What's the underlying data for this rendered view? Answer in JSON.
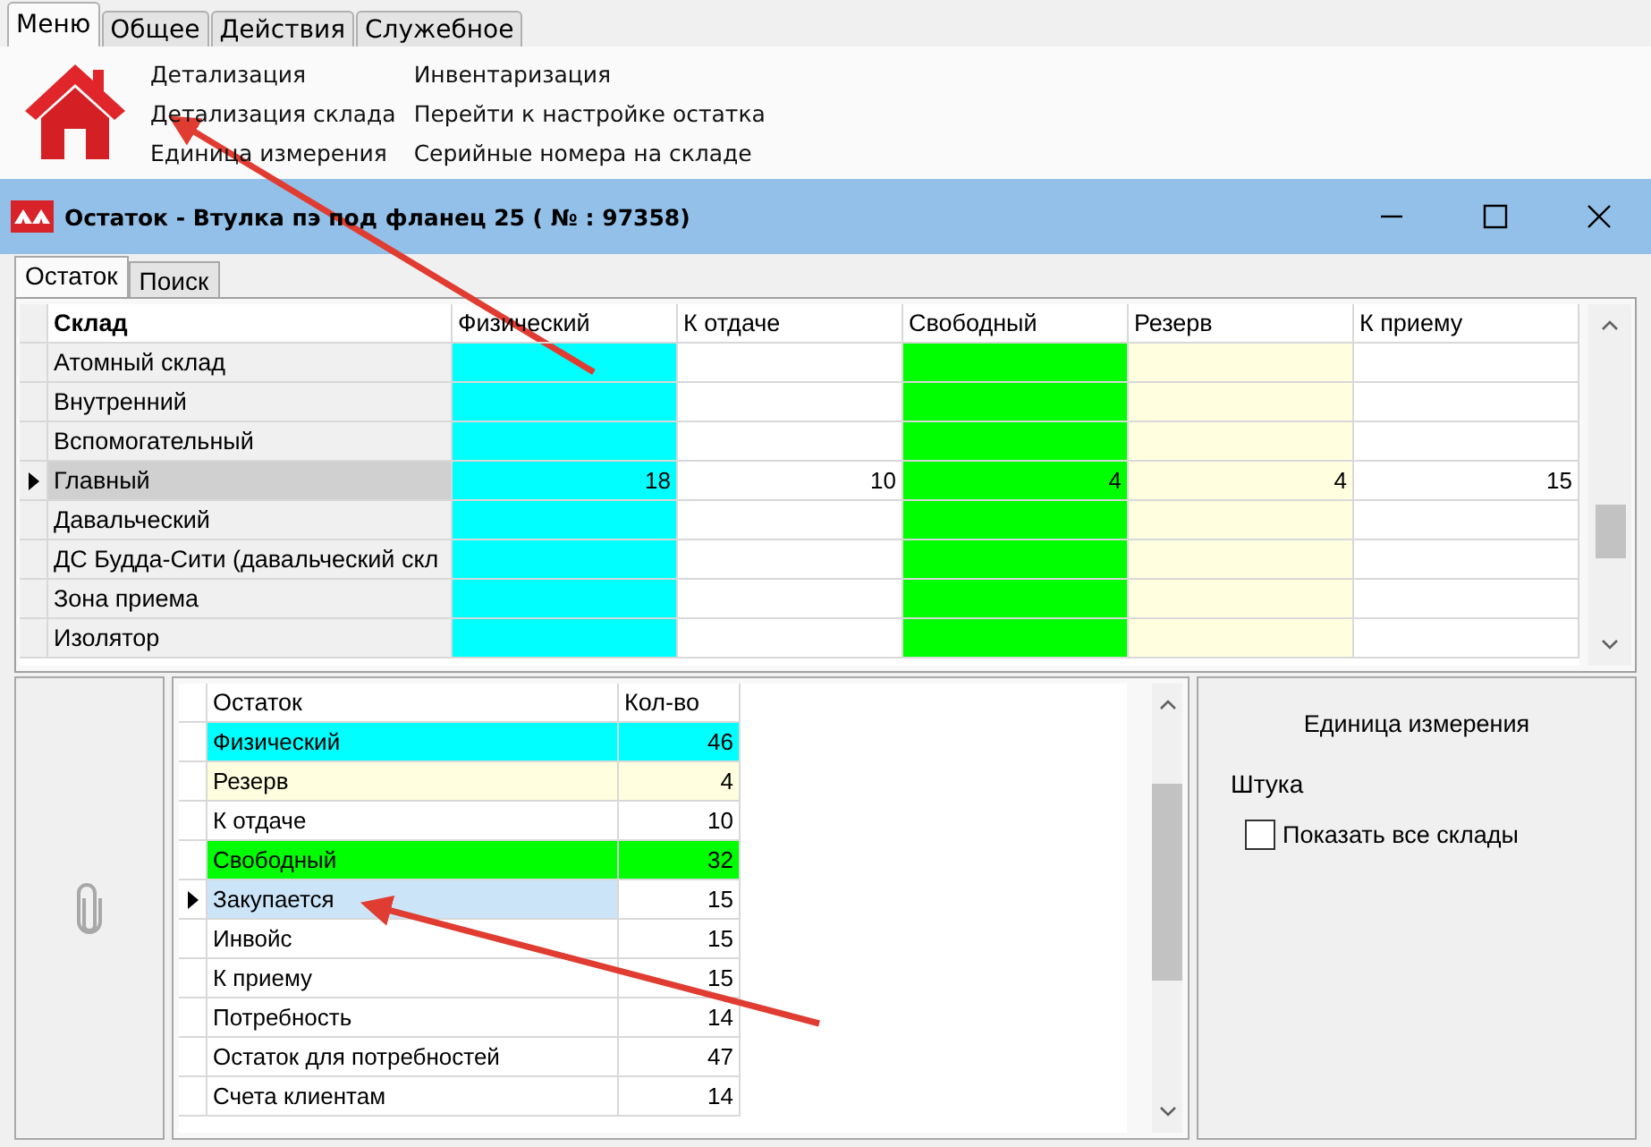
{
  "ribbon_tabs": [
    {
      "label": "Меню",
      "selected": true
    },
    {
      "label": "Общее",
      "selected": false
    },
    {
      "label": "Действия",
      "selected": false
    },
    {
      "label": "Служебное",
      "selected": false
    }
  ],
  "ribbon_links": [
    "Детализация",
    "Детализация склада",
    "Единица измерения",
    "Инвентаризация",
    "Перейти к настройке остатка",
    "Серийные номера на складе"
  ],
  "window": {
    "title": "Остаток - Втулка пэ под фланец 25 ( № : 97358)"
  },
  "tabs": [
    {
      "label": "Остаток",
      "selected": true
    },
    {
      "label": "Поиск",
      "selected": false
    }
  ],
  "stock_table": {
    "columns": [
      {
        "label": "Склад"
      },
      {
        "label": "Физический",
        "color": "#00ffff"
      },
      {
        "label": "К отдаче",
        "color": "#ffffff"
      },
      {
        "label": "Свободный",
        "color": "#00ff00"
      },
      {
        "label": "Резерв",
        "color": "#ffffe0"
      },
      {
        "label": "К приему",
        "color": "#ffffff"
      }
    ],
    "rows": [
      {
        "name": "Атомный склад",
        "selected": false
      },
      {
        "name": "Внутренний",
        "selected": false
      },
      {
        "name": "Вспомогательный",
        "selected": false
      },
      {
        "name": "Главный",
        "selected": true,
        "values": [
          "18",
          "10",
          "4",
          "4",
          "15"
        ]
      },
      {
        "name": "Давальческий",
        "selected": false
      },
      {
        "name": "ДС Будда-Сити (давальческий скл",
        "selected": false
      },
      {
        "name": "Зона приема",
        "selected": false
      },
      {
        "name": "Изолятор",
        "selected": false
      }
    ]
  },
  "summary_table": {
    "columns": [
      "Остаток",
      "Кол-во"
    ],
    "rows": [
      {
        "name": "Физический",
        "qty": "46",
        "color": "#00ffff",
        "selected": false
      },
      {
        "name": "Резерв",
        "qty": "4",
        "color": "#ffffe0",
        "selected": false
      },
      {
        "name": "К отдаче",
        "qty": "10",
        "color": "#ffffff",
        "selected": false
      },
      {
        "name": "Свободный",
        "qty": "32",
        "color": "#00ff00",
        "selected": false
      },
      {
        "name": "Закупается",
        "qty": "15",
        "color": "#ffffff",
        "selected": true
      },
      {
        "name": "Инвойс",
        "qty": "15",
        "color": "#ffffff",
        "selected": false
      },
      {
        "name": "К приему",
        "qty": "15",
        "color": "#ffffff",
        "selected": false
      },
      {
        "name": "Потребность",
        "qty": "14",
        "color": "#ffffff",
        "selected": false
      },
      {
        "name": "Остаток для потребностей",
        "qty": "47",
        "color": "#ffffff",
        "selected": false
      },
      {
        "name": "Счета клиентам",
        "qty": "14",
        "color": "#ffffff",
        "selected": false
      }
    ]
  },
  "unit_panel": {
    "heading": "Единица измерения",
    "unit": "Штука",
    "show_all": {
      "label": "Показать все склады",
      "checked": false
    }
  }
}
